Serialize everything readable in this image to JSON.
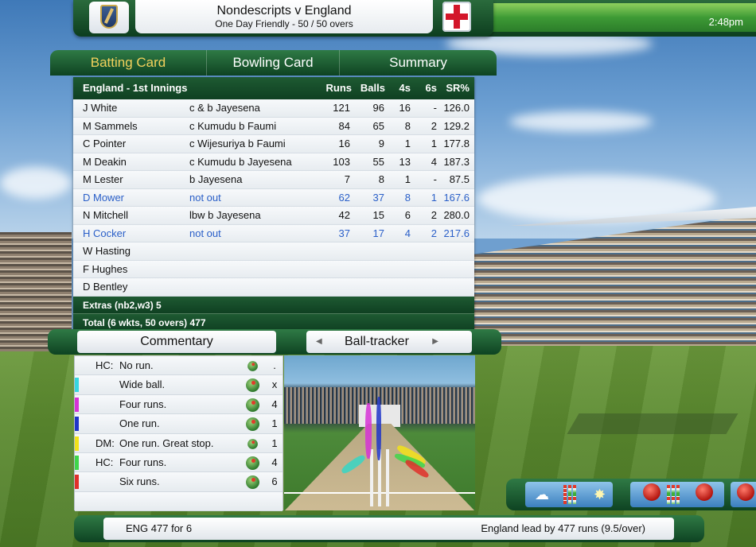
{
  "header": {
    "match_title": "Nondescripts v England",
    "match_subtitle": "One Day Friendly - 50 / 50 overs",
    "clock": "2:48pm"
  },
  "tabs": [
    {
      "label": "Batting Card",
      "active": true
    },
    {
      "label": "Bowling Card",
      "active": false
    },
    {
      "label": "Summary",
      "active": false
    }
  ],
  "scorecard": {
    "innings": "England - 1st Innings",
    "columns": {
      "runs": "Runs",
      "balls": "Balls",
      "fours": "4s",
      "sixes": "6s",
      "sr": "SR%"
    },
    "batters": [
      {
        "name": "J White",
        "how_out": "c & b Jayesena",
        "runs": "121",
        "balls": "96",
        "fours": "16",
        "sixes": "-",
        "sr": "126.0",
        "not_out": false
      },
      {
        "name": "M Sammels",
        "how_out": "c Kumudu b Faumi",
        "runs": "84",
        "balls": "65",
        "fours": "8",
        "sixes": "2",
        "sr": "129.2",
        "not_out": false
      },
      {
        "name": "C Pointer",
        "how_out": "c Wijesuriya b Faumi",
        "runs": "16",
        "balls": "9",
        "fours": "1",
        "sixes": "1",
        "sr": "177.8",
        "not_out": false
      },
      {
        "name": "M Deakin",
        "how_out": "c Kumudu b Jayesena",
        "runs": "103",
        "balls": "55",
        "fours": "13",
        "sixes": "4",
        "sr": "187.3",
        "not_out": false
      },
      {
        "name": "M Lester",
        "how_out": "b Jayesena",
        "runs": "7",
        "balls": "8",
        "fours": "1",
        "sixes": "-",
        "sr": "87.5",
        "not_out": false
      },
      {
        "name": "D Mower",
        "how_out": "not out",
        "runs": "62",
        "balls": "37",
        "fours": "8",
        "sixes": "1",
        "sr": "167.6",
        "not_out": true
      },
      {
        "name": "N Mitchell",
        "how_out": "lbw b Jayesena",
        "runs": "42",
        "balls": "15",
        "fours": "6",
        "sixes": "2",
        "sr": "280.0",
        "not_out": false
      },
      {
        "name": "H Cocker",
        "how_out": "not out",
        "runs": "37",
        "balls": "17",
        "fours": "4",
        "sixes": "2",
        "sr": "217.6",
        "not_out": true
      },
      {
        "name": "W Hasting",
        "how_out": "",
        "runs": "",
        "balls": "",
        "fours": "",
        "sixes": "",
        "sr": "",
        "not_out": false
      },
      {
        "name": "F Hughes",
        "how_out": "",
        "runs": "",
        "balls": "",
        "fours": "",
        "sixes": "",
        "sr": "",
        "not_out": false
      },
      {
        "name": "D Bentley",
        "how_out": "",
        "runs": "",
        "balls": "",
        "fours": "",
        "sixes": "",
        "sr": "",
        "not_out": false
      }
    ],
    "extras": "Extras (nb2,w3) 5",
    "total": "Total (6 wkts, 50 overs) 477"
  },
  "lower_tabs": {
    "commentary": "Commentary",
    "ball_tracker": "Ball-tracker"
  },
  "commentary": [
    {
      "prefix": "HC:",
      "text": "No run.",
      "result": ".",
      "marker_color": ""
    },
    {
      "prefix": "",
      "text": "Wide ball.",
      "result": "x",
      "marker_color": "#37d6e0"
    },
    {
      "prefix": "",
      "text": "Four runs.",
      "result": "4",
      "marker_color": "#d633d6"
    },
    {
      "prefix": "",
      "text": "One run.",
      "result": "1",
      "marker_color": "#1f35c8"
    },
    {
      "prefix": "DM:",
      "text": "One run. Great stop.",
      "result": "1",
      "marker_color": "#f2e21a"
    },
    {
      "prefix": "HC:",
      "text": "Four runs.",
      "result": "4",
      "marker_color": "#3fd64a"
    },
    {
      "prefix": "",
      "text": "Six runs.",
      "result": "6",
      "marker_color": "#e0302a"
    }
  ],
  "status": {
    "score": "ENG  477 for 6",
    "lead": "England lead by 477 runs (9.5/over)"
  },
  "icons": {
    "crest": "cricket-club-crest-icon",
    "flag": "england-flag-icon",
    "weather": "cloud-icon",
    "light": "light-bulb-icon",
    "ball": "cricket-ball-icon"
  }
}
